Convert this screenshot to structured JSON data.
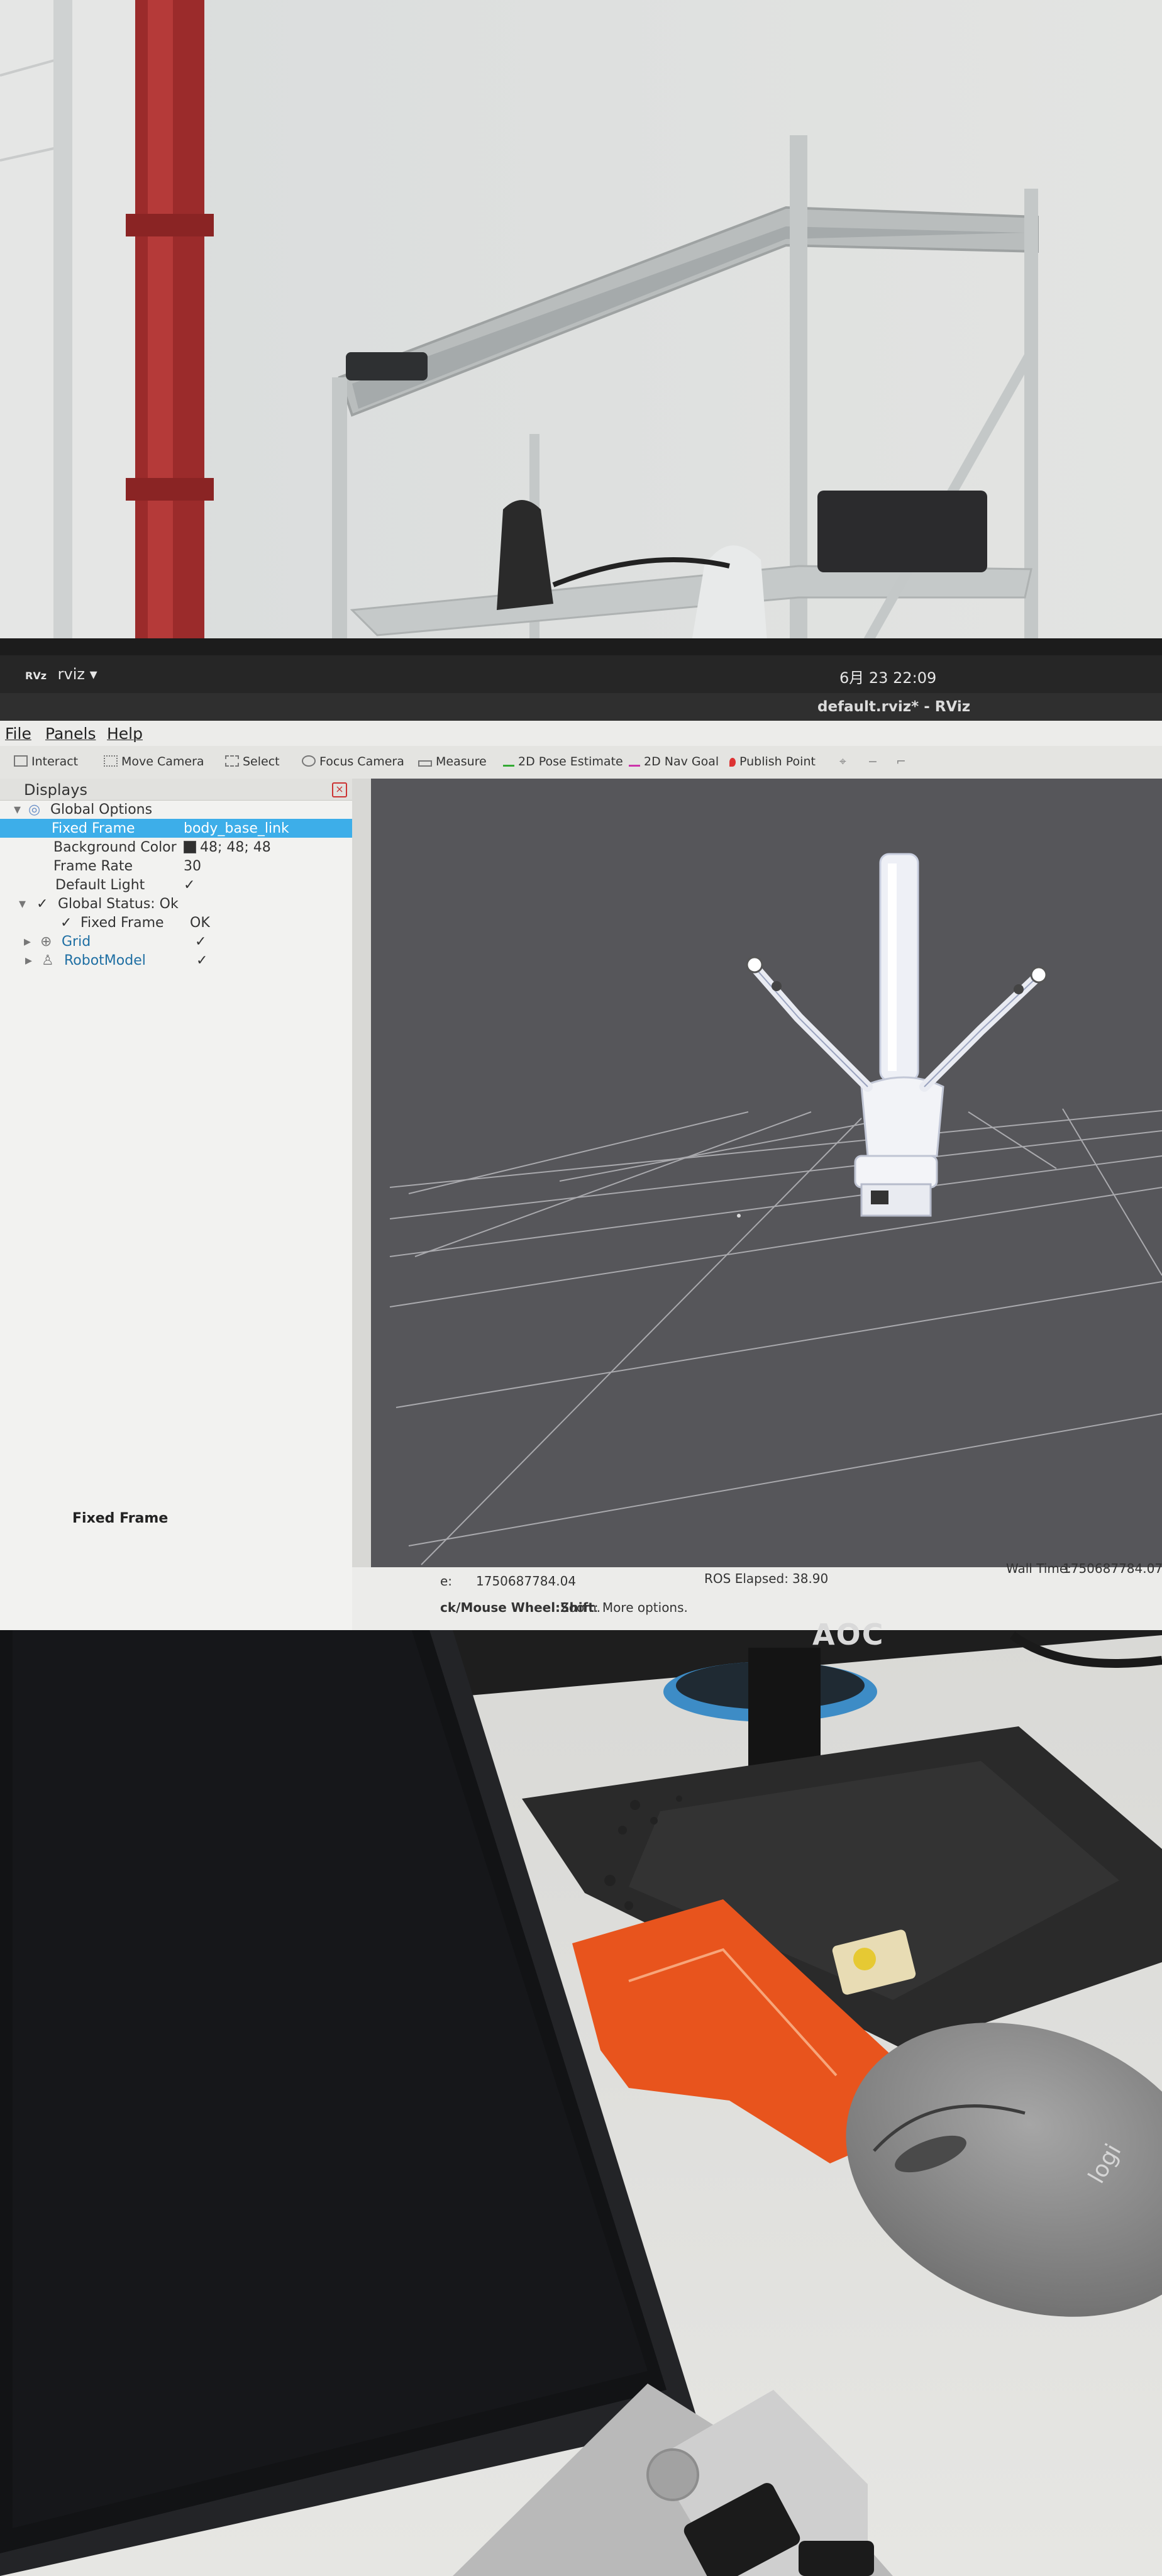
{
  "topbar": {
    "app_logo": "RVz",
    "app_name": "rviz ▾",
    "clock": "6月 23  22:09"
  },
  "window": {
    "title": "default.rviz* - RViz"
  },
  "menu": [
    "File",
    "Panels",
    "Help"
  ],
  "toolbar": [
    "Interact",
    "Move Camera",
    "Select",
    "Focus Camera",
    "Measure",
    "2D Pose Estimate",
    "2D Nav Goal",
    "Publish Point"
  ],
  "displays": {
    "header": "Displays",
    "rows": [
      {
        "key": "Global Options"
      },
      {
        "key": "Fixed Frame",
        "value": "body_base_link"
      },
      {
        "key": "Background Color",
        "value": "48; 48; 48"
      },
      {
        "key": "Frame Rate",
        "value": "30"
      },
      {
        "key": "Default Light",
        "value": "✓"
      },
      {
        "key": "Global Status: Ok"
      },
      {
        "key": "Fixed Frame",
        "value": "OK"
      },
      {
        "key": "Grid",
        "value": "✓"
      },
      {
        "key": "RobotModel",
        "value": "✓"
      }
    ],
    "description_title": "Fixed Frame"
  },
  "status": {
    "ros_time_label": "e:",
    "ros_time": "1750687784.04",
    "ros_elapsed_label": "ROS Elapsed:",
    "ros_elapsed": "38.90",
    "wall_time_label": "Wall Time:",
    "wall_time": "1750687784.07",
    "hint_bold1": "ck/Mouse Wheel:",
    "hint_text1": " Zoom. ",
    "hint_bold2": "Shift",
    "hint_text2": ": More options."
  },
  "monitor_brand": "AOC",
  "mouse_brand": "logi"
}
